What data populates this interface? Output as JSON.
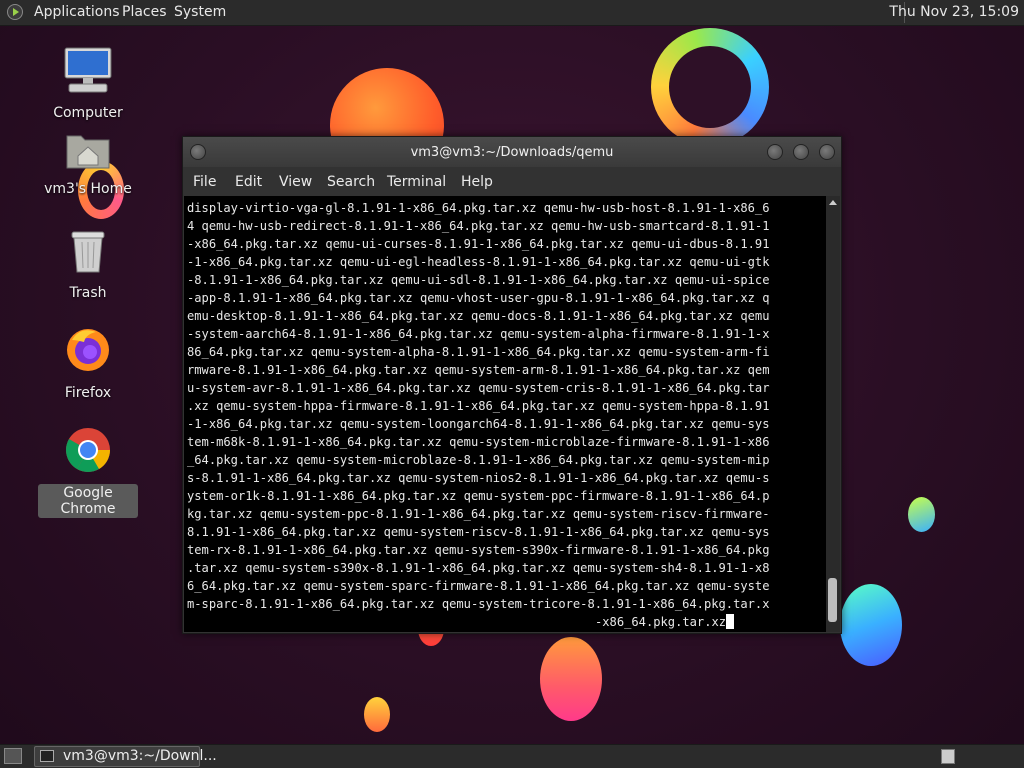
{
  "top_panel": {
    "menus": [
      "Applications",
      "Places",
      "System"
    ],
    "clock": "Thu Nov 23, 15:09"
  },
  "desktop_icons": [
    {
      "label": "Computer",
      "icon": "computer-icon"
    },
    {
      "label": "vm3's Home",
      "icon": "home-folder-icon"
    },
    {
      "label": "Trash",
      "icon": "trash-icon"
    },
    {
      "label": "Firefox",
      "icon": "firefox-icon"
    },
    {
      "label": "Google Chrome",
      "icon": "chrome-icon",
      "selected": true
    }
  ],
  "terminal": {
    "title": "vm3@vm3:~/Downloads/qemu",
    "menu": [
      "File",
      "Edit",
      "View",
      "Search",
      "Terminal",
      "Help"
    ],
    "lines": [
      "display-virtio-vga-gl-8.1.91-1-x86_64.pkg.tar.xz qemu-hw-usb-host-8.1.91-1-x86_6",
      "4 qemu-hw-usb-redirect-8.1.91-1-x86_64.pkg.tar.xz qemu-hw-usb-smartcard-8.1.91-1",
      "-x86_64.pkg.tar.xz qemu-ui-curses-8.1.91-1-x86_64.pkg.tar.xz qemu-ui-dbus-8.1.91",
      "-1-x86_64.pkg.tar.xz qemu-ui-egl-headless-8.1.91-1-x86_64.pkg.tar.xz qemu-ui-gtk",
      "-8.1.91-1-x86_64.pkg.tar.xz qemu-ui-sdl-8.1.91-1-x86_64.pkg.tar.xz qemu-ui-spice",
      "-app-8.1.91-1-x86_64.pkg.tar.xz qemu-vhost-user-gpu-8.1.91-1-x86_64.pkg.tar.xz q",
      "emu-desktop-8.1.91-1-x86_64.pkg.tar.xz qemu-docs-8.1.91-1-x86_64.pkg.tar.xz qemu",
      "-system-aarch64-8.1.91-1-x86_64.pkg.tar.xz qemu-system-alpha-firmware-8.1.91-1-x",
      "86_64.pkg.tar.xz qemu-system-alpha-8.1.91-1-x86_64.pkg.tar.xz qemu-system-arm-fi",
      "rmware-8.1.91-1-x86_64.pkg.tar.xz qemu-system-arm-8.1.91-1-x86_64.pkg.tar.xz qem",
      "u-system-avr-8.1.91-1-x86_64.pkg.tar.xz qemu-system-cris-8.1.91-1-x86_64.pkg.tar",
      ".xz qemu-system-hppa-firmware-8.1.91-1-x86_64.pkg.tar.xz qemu-system-hppa-8.1.91",
      "-1-x86_64.pkg.tar.xz qemu-system-loongarch64-8.1.91-1-x86_64.pkg.tar.xz qemu-sys",
      "tem-m68k-8.1.91-1-x86_64.pkg.tar.xz qemu-system-microblaze-firmware-8.1.91-1-x86",
      "_64.pkg.tar.xz qemu-system-microblaze-8.1.91-1-x86_64.pkg.tar.xz qemu-system-mip",
      "s-8.1.91-1-x86_64.pkg.tar.xz qemu-system-nios2-8.1.91-1-x86_64.pkg.tar.xz qemu-s",
      "ystem-or1k-8.1.91-1-x86_64.pkg.tar.xz qemu-system-ppc-firmware-8.1.91-1-x86_64.p",
      "kg.tar.xz qemu-system-ppc-8.1.91-1-x86_64.pkg.tar.xz qemu-system-riscv-firmware-",
      "8.1.91-1-x86_64.pkg.tar.xz qemu-system-riscv-8.1.91-1-x86_64.pkg.tar.xz qemu-sys",
      "tem-rx-8.1.91-1-x86_64.pkg.tar.xz qemu-system-s390x-firmware-8.1.91-1-x86_64.pkg",
      ".tar.xz qemu-system-s390x-8.1.91-1-x86_64.pkg.tar.xz qemu-system-sh4-8.1.91-1-x8",
      "6_64.pkg.tar.xz qemu-system-sparc-firmware-8.1.91-1-x86_64.pkg.tar.xz qemu-syste",
      "m-sparc-8.1.91-1-x86_64.pkg.tar.xz qemu-system-tricore-8.1.91-1-x86_64.pkg.tar.x"
    ],
    "last_line": "-x86_64.pkg.tar.xz"
  },
  "taskbar": {
    "task_label": "vm3@vm3:~/Downl..."
  }
}
